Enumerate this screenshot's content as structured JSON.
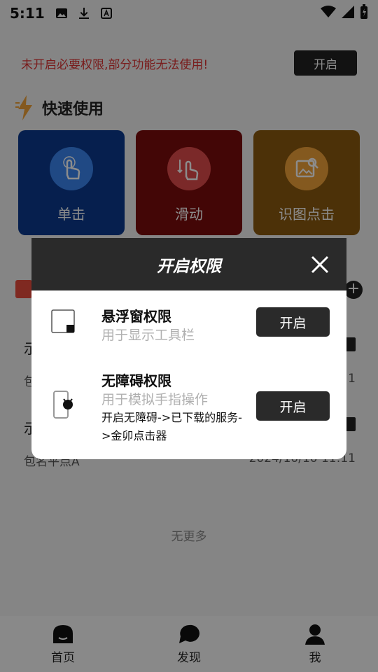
{
  "status_bar": {
    "time": "5:11",
    "left_icons": [
      "image-icon",
      "download-icon",
      "text-icon"
    ],
    "right_icons": [
      "wifi-icon",
      "signal-icon",
      "battery-icon"
    ]
  },
  "warning": {
    "text": "未开启必要权限,部分功能无法使用!",
    "button_label": "开启",
    "color": "#dd3333"
  },
  "quick_section": {
    "title": "快速使用",
    "items": [
      {
        "label": "单击",
        "icon": "tap-hand-icon",
        "color": "#3b86f0"
      },
      {
        "label": "滑动",
        "icon": "swipe-hand-icon",
        "color": "#e14c4c"
      },
      {
        "label": "识图点击",
        "icon": "image-search-icon",
        "color": "#f1a23a"
      }
    ]
  },
  "records": [
    {
      "title": "示",
      "subtitle": "包",
      "time": "1"
    },
    {
      "title": "示",
      "subtitle": "包名平点A",
      "time": "2024/10/10 11:11"
    }
  ],
  "no_more_text": "无更多",
  "dialog": {
    "title": "开启权限",
    "permissions": [
      {
        "title": "悬浮窗权限",
        "desc": "用于显示工具栏",
        "button_label": "开启"
      },
      {
        "title": "无障碍权限",
        "desc": "用于模拟手指操作",
        "extra": "开启无障碍->已下载的服务->金卯点击器",
        "button_label": "开启"
      }
    ]
  },
  "tabbar": {
    "tabs": [
      {
        "label": "首页",
        "icon": "home-icon"
      },
      {
        "label": "发现",
        "icon": "discover-icon"
      },
      {
        "label": "我",
        "icon": "user-icon"
      }
    ]
  }
}
